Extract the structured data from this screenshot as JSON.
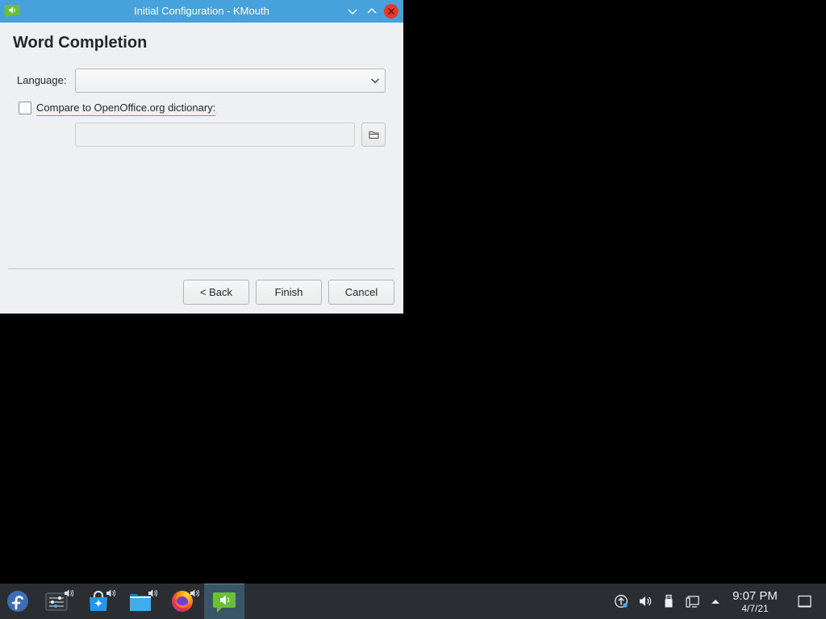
{
  "colors": {
    "titlebar": "#47a1db",
    "window_bg": "#eff0f1",
    "accent": "#3daee9",
    "taskbar_bg": "#2a2e32",
    "close_button": "#e2382d"
  },
  "window": {
    "title": "Initial Configuration - KMouth",
    "app_icon": "kmouth-icon",
    "controls": [
      "chevron-down-icon",
      "chevron-up-icon",
      "close-icon"
    ]
  },
  "wizard_page": {
    "heading": "Word Completion",
    "language": {
      "label": "Language:",
      "selected": ""
    },
    "compare_dictionary": {
      "label": "Compare to OpenOffice.org dictionary:",
      "checked": false
    },
    "dictionary_path": {
      "value": "",
      "disabled": true,
      "browse_icon": "folder-icon"
    }
  },
  "buttons": {
    "back": "< Back",
    "finish": "Finish",
    "cancel": "Cancel"
  },
  "taskbar": {
    "launcher_icon": "fedora-icon",
    "tasks": [
      {
        "icon": "system-settings-icon",
        "badge": "speaker-icon",
        "active": false
      },
      {
        "icon": "discover-icon",
        "badge": "speaker-icon",
        "active": false
      },
      {
        "icon": "dolphin-folder-icon",
        "badge": "speaker-icon",
        "active": false
      },
      {
        "icon": "firefox-icon",
        "badge": "speaker-icon",
        "active": false
      },
      {
        "icon": "kmouth-icon",
        "active": true
      }
    ],
    "tray": [
      "updates-icon",
      "volume-icon",
      "removable-device-icon",
      "network-wired-icon",
      "expand-tray-icon"
    ],
    "clock": {
      "time": "9:07 PM",
      "date": "4/7/21"
    },
    "show_desktop_icon": "show-desktop-icon"
  }
}
